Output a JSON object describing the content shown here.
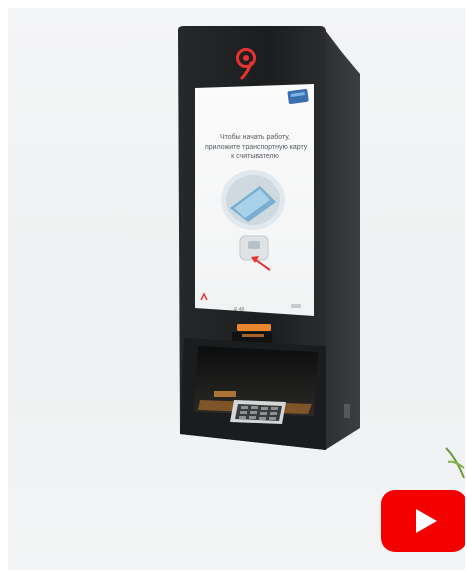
{
  "kiosk": {
    "screen_text": [
      "Чтобы начать работу,",
      "приложите транспортную карту",
      "к считывателю"
    ],
    "price_text": "₽ 48"
  },
  "video": {
    "play_icon": "youtube-play-icon",
    "brand_color": "#f40000"
  },
  "colors": {
    "kiosk_body": "#1f2123",
    "logo_red": "#e7322f",
    "accent_orange": "#e8862d"
  }
}
